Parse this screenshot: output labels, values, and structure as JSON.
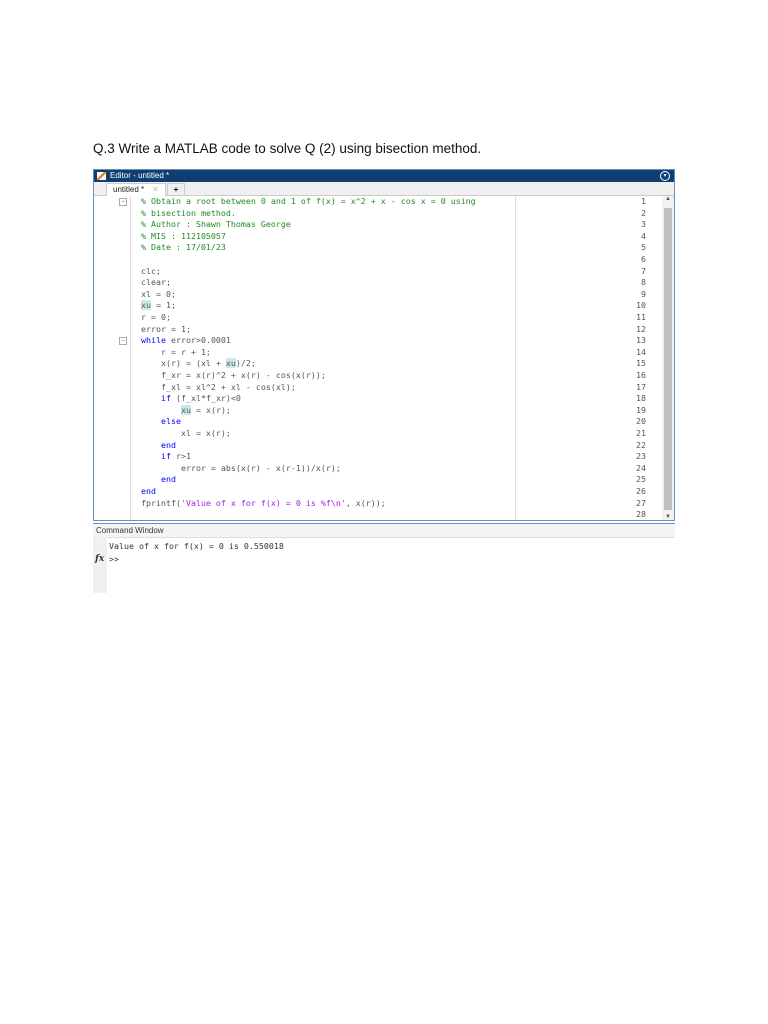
{
  "question": "Q.3 Write a MATLAB code to solve Q (2) using bisection method.",
  "editor": {
    "title": "Editor - untitled *",
    "tab_label": "untitled *",
    "close_glyph": "✕",
    "add_tab": "+",
    "menu_glyph": "▾",
    "lines": [
      [
        {
          "t": "% Obtain a root between 0 and 1 of f(x) = x^2 + x - cos x = 0 using",
          "c": "comment"
        }
      ],
      [
        {
          "t": "% bisection method.",
          "c": "comment"
        }
      ],
      [
        {
          "t": "% Author : Shawn Thomas George",
          "c": "comment"
        }
      ],
      [
        {
          "t": "% MIS : 112105057",
          "c": "comment"
        }
      ],
      [
        {
          "t": "% Date : 17/01/23",
          "c": "comment"
        }
      ],
      [],
      [
        {
          "t": "clc;"
        }
      ],
      [
        {
          "t": "clear;"
        }
      ],
      [
        {
          "t": "xl = 0;"
        }
      ],
      [
        {
          "t": "xu",
          "c": "hl"
        },
        {
          "t": " = 1;"
        }
      ],
      [
        {
          "t": "r = 0;"
        }
      ],
      [
        {
          "t": "error = 1;"
        }
      ],
      [
        {
          "t": "while",
          "c": "kw"
        },
        {
          "t": " error>0.0001"
        }
      ],
      [
        {
          "t": "    r = r + 1;"
        }
      ],
      [
        {
          "t": "    x(r) = (xl + "
        },
        {
          "t": "xu",
          "c": "hl"
        },
        {
          "t": ")/2;"
        }
      ],
      [
        {
          "t": "    f_xr = x(r)^2 + x(r) - cos(x(r));"
        }
      ],
      [
        {
          "t": "    f_xl = xl^2 + xl - cos(xl);"
        }
      ],
      [
        {
          "t": "    "
        },
        {
          "t": "if",
          "c": "kw"
        },
        {
          "t": " (f_xl*f_xr)<0"
        }
      ],
      [
        {
          "t": "        "
        },
        {
          "t": "xu",
          "c": "hl"
        },
        {
          "t": " = x(r);"
        }
      ],
      [
        {
          "t": "    "
        },
        {
          "t": "else",
          "c": "kw"
        }
      ],
      [
        {
          "t": "        xl = x(r);"
        }
      ],
      [
        {
          "t": "    "
        },
        {
          "t": "end",
          "c": "kw"
        }
      ],
      [
        {
          "t": "    "
        },
        {
          "t": "if",
          "c": "kw"
        },
        {
          "t": " r>1"
        }
      ],
      [
        {
          "t": "        error = abs(x(r) - x(r-1))/x(r);"
        }
      ],
      [
        {
          "t": "    "
        },
        {
          "t": "end",
          "c": "kw"
        }
      ],
      [
        {
          "t": "end",
          "c": "kw"
        }
      ],
      [
        {
          "t": "fprintf("
        },
        {
          "t": "'Value of x for f(x) = 0 is %f\\n'",
          "c": "str"
        },
        {
          "t": ", x(r));"
        }
      ],
      []
    ],
    "fold_lines": [
      1,
      13
    ]
  },
  "command_window": {
    "title": "Command Window",
    "output": "Value of x for f(x) = 0 is 0.550018",
    "prompt": ">>",
    "fx": "fx"
  }
}
